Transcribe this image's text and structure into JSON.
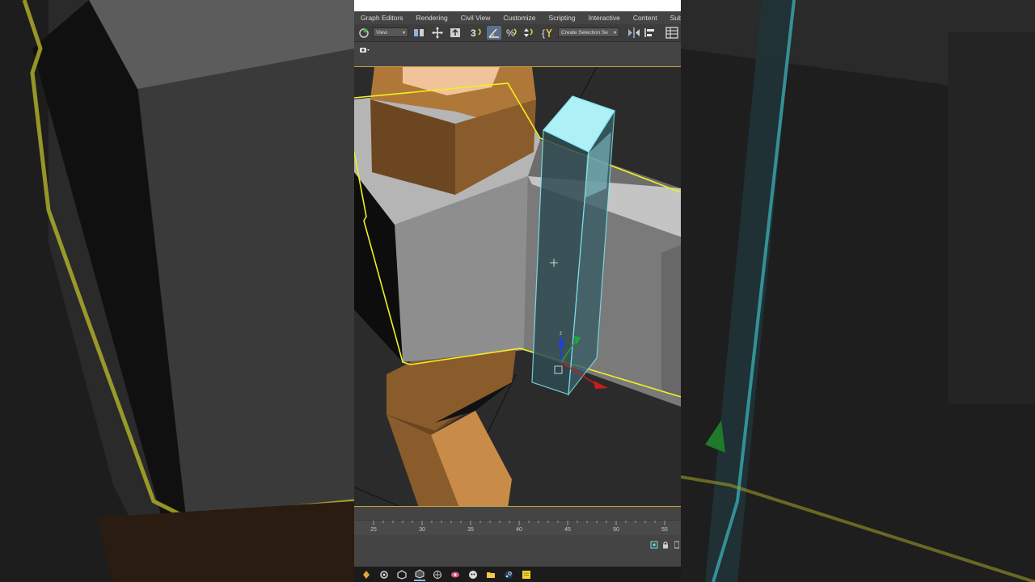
{
  "menu": {
    "items": [
      "Graph Editors",
      "Rendering",
      "Civil View",
      "Customize",
      "Scripting",
      "Interactive",
      "Content",
      "Subst"
    ]
  },
  "toolbar": {
    "reference_coord_value": "View",
    "named_selection_value": "Create Selection Se"
  },
  "viewport": {
    "gizmo_axis_z": "z"
  },
  "timeline": {
    "ticks": [
      "25",
      "30",
      "35",
      "40",
      "45",
      "50",
      "55"
    ]
  },
  "colors": {
    "selection_outline": "#f0f020",
    "selected_object": "#7fdde4",
    "wood": "#c98b48",
    "stone": "#8f8f8f"
  }
}
